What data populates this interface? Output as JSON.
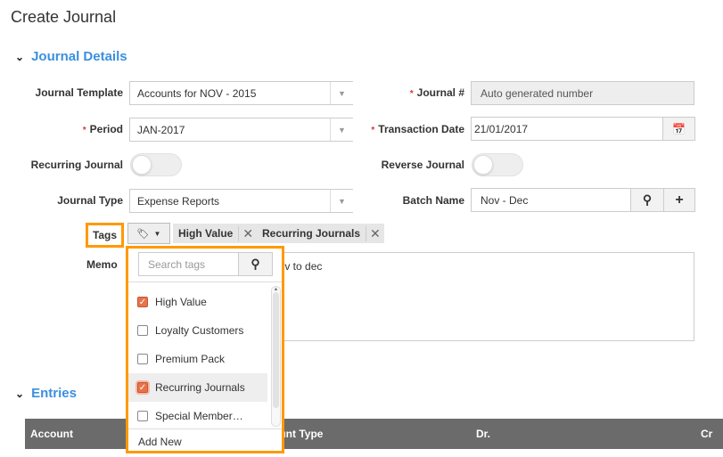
{
  "page": {
    "title": "Create Journal"
  },
  "journal_details": {
    "heading": "Journal Details",
    "journal_template": {
      "label": "Journal Template",
      "value": "Accounts for NOV - 2015"
    },
    "journal_number": {
      "label": "Journal #",
      "placeholder": "Auto generated number"
    },
    "period": {
      "label": "Period",
      "value": "JAN-2017"
    },
    "transaction_date": {
      "label": "Transaction Date",
      "value": "21/01/2017"
    },
    "recurring_journal": {
      "label": "Recurring Journal",
      "on": false
    },
    "reverse_journal": {
      "label": "Reverse Journal",
      "on": false
    },
    "journal_type": {
      "label": "Journal Type",
      "value": "Expense Reports"
    },
    "batch_name": {
      "label": "Batch Name",
      "value": "Nov - Dec"
    },
    "tags": {
      "label": "Tags",
      "selected": [
        "High Value",
        "Recurring Journals"
      ]
    },
    "memo": {
      "label": "Memo",
      "value": "Nov to dec"
    }
  },
  "tag_dropdown": {
    "search_placeholder": "Search tags",
    "items": [
      {
        "label": "High Value",
        "checked": true
      },
      {
        "label": "Loyalty Customers",
        "checked": false
      },
      {
        "label": "Premium Pack",
        "checked": false
      },
      {
        "label": "Recurring Journals",
        "checked": true
      },
      {
        "label": "Special Member…",
        "checked": false
      }
    ],
    "add_new": "Add New"
  },
  "entries": {
    "heading": "Entries",
    "columns": [
      "Account",
      "Account Type",
      "Dr.",
      "Cr"
    ]
  },
  "colors": {
    "accent": "#3b8fe0",
    "highlight": "#ff9900",
    "checkbox": "#e8734a",
    "table_header": "#6b6b6b"
  }
}
